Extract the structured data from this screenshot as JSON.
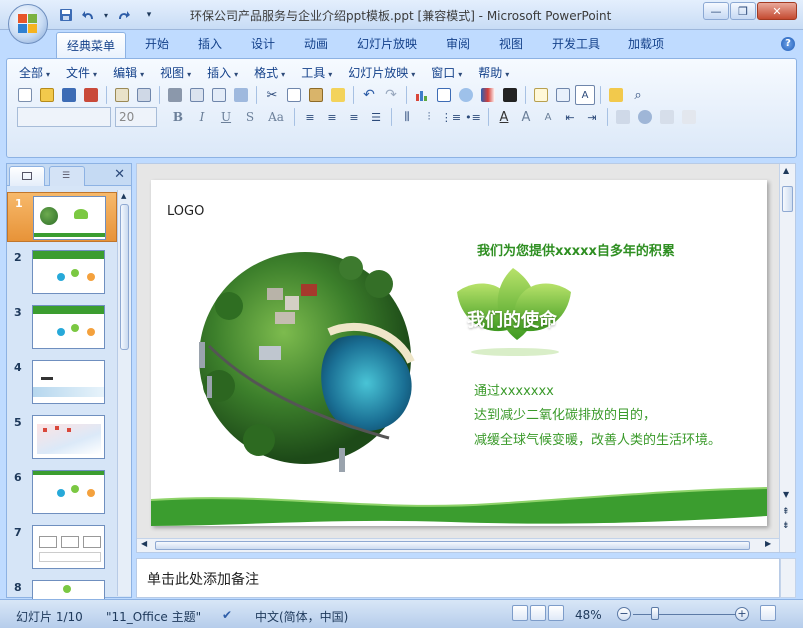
{
  "window": {
    "title": "环保公司产品服务与企业介绍ppt模板.ppt [兼容模式] - Microsoft PowerPoint"
  },
  "ribbon_tabs": [
    {
      "label": "经典菜单",
      "active": true
    },
    {
      "label": "开始"
    },
    {
      "label": "插入"
    },
    {
      "label": "设计"
    },
    {
      "label": "动画"
    },
    {
      "label": "幻灯片放映"
    },
    {
      "label": "审阅"
    },
    {
      "label": "视图"
    },
    {
      "label": "开发工具"
    },
    {
      "label": "加载项"
    }
  ],
  "menu": [
    {
      "label": "全部"
    },
    {
      "label": "文件"
    },
    {
      "label": "编辑"
    },
    {
      "label": "视图"
    },
    {
      "label": "插入"
    },
    {
      "label": "格式"
    },
    {
      "label": "工具"
    },
    {
      "label": "幻灯片放映"
    },
    {
      "label": "窗口"
    },
    {
      "label": "帮助"
    }
  ],
  "format": {
    "font_size": "20",
    "bold": "B",
    "italic": "I",
    "underline": "U",
    "shadow": "S",
    "char_spacing": "Aa"
  },
  "slide": {
    "logo": "LOGO",
    "headline": "我们为您提供xxxxx自多年的积累",
    "mission": "我们的使命",
    "line1": "通过xxxxxxx",
    "line2": "达到减少二氧化碳排放的目的，",
    "line3": "减缓全球气候变暖，改善人类的生活环境。",
    "colors": {
      "green": "#3b9d2f",
      "leaf": "#7bc842"
    }
  },
  "thumbnails": [
    {
      "num": "1"
    },
    {
      "num": "2"
    },
    {
      "num": "3"
    },
    {
      "num": "4"
    },
    {
      "num": "5"
    },
    {
      "num": "6"
    },
    {
      "num": "7"
    },
    {
      "num": "8"
    }
  ],
  "notes": {
    "placeholder": "单击此处添加备注"
  },
  "status": {
    "slide": "幻灯片 1/10",
    "theme": "\"11_Office 主题\"",
    "language": "中文(简体，中国)",
    "zoom": "48%"
  }
}
